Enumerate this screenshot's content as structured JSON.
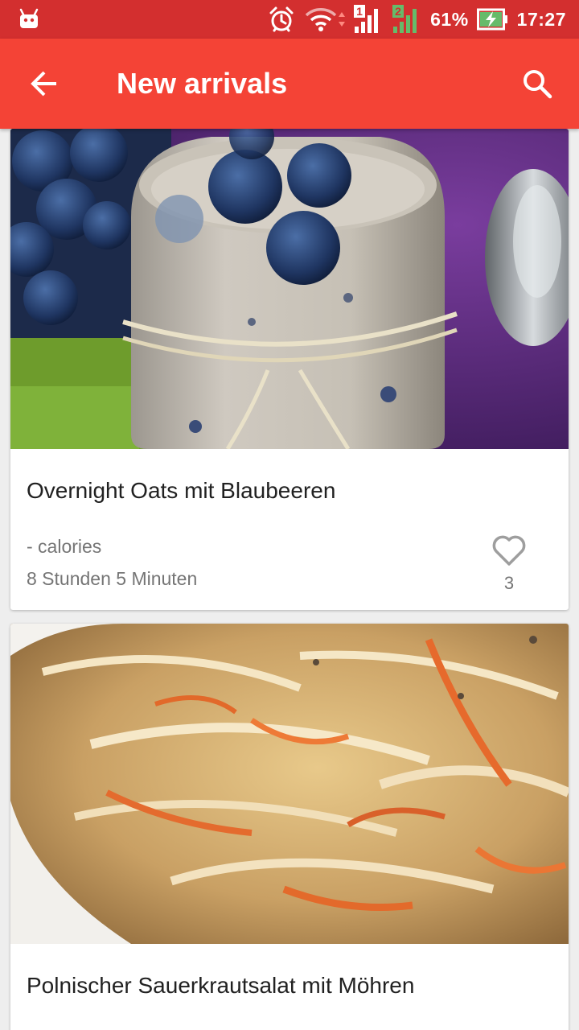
{
  "status_bar": {
    "battery_percent": "61%",
    "time": "17:27",
    "sim1_label": "1",
    "sim2_label": "2"
  },
  "app_bar": {
    "title": "New arrivals",
    "back_icon": "arrow-back-icon",
    "search_icon": "search-icon"
  },
  "colors": {
    "status_bar": "#d32f2f",
    "app_bar": "#f44336",
    "background": "#eeeeee"
  },
  "recipes": [
    {
      "title": "Overnight Oats mit Blaubeeren",
      "calories": "- calories",
      "time": "8 Stunden 5 Minuten",
      "likes": "3",
      "image_subject": "overnight oats jar with blueberries"
    },
    {
      "title": "Polnischer Sauerkrautsalat mit Möhren",
      "image_subject": "sauerkraut salad with carrots"
    }
  ]
}
